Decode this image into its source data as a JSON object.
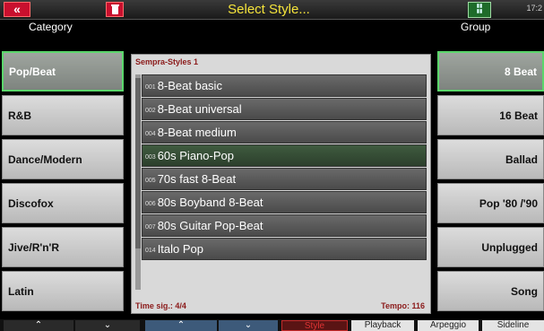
{
  "topbar": {
    "back_icon": "double-chevron-left",
    "title": "Select Style...",
    "time": "17:2"
  },
  "headers": {
    "category": "Category",
    "group": "Group"
  },
  "categories": [
    {
      "label": "Pop/Beat",
      "active": true
    },
    {
      "label": "R&B",
      "active": false
    },
    {
      "label": "Dance/Modern",
      "active": false
    },
    {
      "label": "Discofox",
      "active": false
    },
    {
      "label": "Jive/R'n'R",
      "active": false
    },
    {
      "label": "Latin",
      "active": false
    }
  ],
  "groups": [
    {
      "label": "8 Beat",
      "active": true
    },
    {
      "label": "16 Beat",
      "active": false
    },
    {
      "label": "Ballad",
      "active": false
    },
    {
      "label": "Pop '80 /'90",
      "active": false
    },
    {
      "label": "Unplugged",
      "active": false
    },
    {
      "label": "Song",
      "active": false
    }
  ],
  "list": {
    "title": "Sempra-Styles 1",
    "items": [
      {
        "num": "001",
        "name": "8-Beat basic"
      },
      {
        "num": "002",
        "name": "8-Beat universal"
      },
      {
        "num": "004",
        "name": "8-Beat medium"
      },
      {
        "num": "003",
        "name": "60s Piano-Pop",
        "selected": true
      },
      {
        "num": "005",
        "name": "70s fast 8-Beat"
      },
      {
        "num": "006",
        "name": "80s Boyband 8-Beat"
      },
      {
        "num": "007",
        "name": "80s Guitar Pop-Beat"
      },
      {
        "num": "014",
        "name": "Italo Pop"
      }
    ],
    "time_sig": "Time sig.: 4/4",
    "tempo": "Tempo: 116"
  },
  "bottom": {
    "up1": "⌃",
    "down1": "⌄",
    "up2": "⌃",
    "down2": "⌄",
    "style": "Style",
    "playback": "Playback",
    "arpeggio": "Arpeggio",
    "sideline": "Sideline"
  }
}
